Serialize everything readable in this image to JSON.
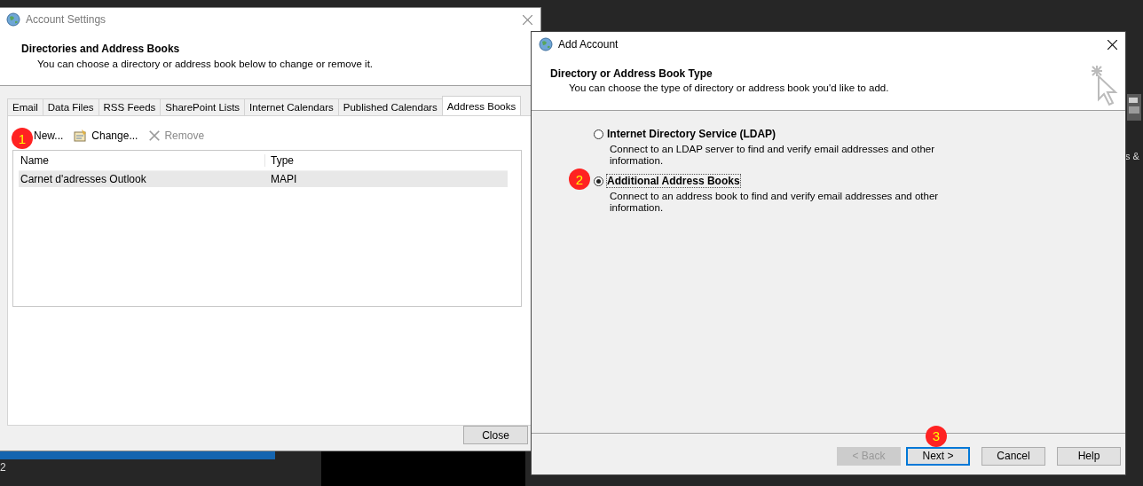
{
  "background": {
    "texts": [
      {
        "text": "2",
        "selected": false
      }
    ],
    "side_text": "s &"
  },
  "account_settings": {
    "title": "Account Settings",
    "header_title": "Directories and Address Books",
    "header_subtitle": "You can choose a directory or address book below to change or remove it.",
    "tabs": [
      {
        "label": "Email",
        "selected": false
      },
      {
        "label": "Data Files",
        "selected": false
      },
      {
        "label": "RSS Feeds",
        "selected": false
      },
      {
        "label": "SharePoint Lists",
        "selected": false
      },
      {
        "label": "Internet Calendars",
        "selected": false
      },
      {
        "label": "Published Calendars",
        "selected": false
      },
      {
        "label": "Address Books",
        "selected": true
      }
    ],
    "toolbar": [
      {
        "kind": "new",
        "label": "New...",
        "disabled": false,
        "badge": "1"
      },
      {
        "kind": "change",
        "label": "Change...",
        "disabled": false
      },
      {
        "kind": "remove",
        "label": "Remove",
        "disabled": true
      }
    ],
    "table": {
      "columns": [
        "Name",
        "Type"
      ],
      "rows": [
        {
          "name": "Carnet d'adresses Outlook",
          "type": "MAPI",
          "selected": true
        }
      ]
    },
    "close_button": "Close"
  },
  "add_account": {
    "title": "Add Account",
    "header_title": "Directory or Address Book Type",
    "header_subtitle": "You can choose the type of directory or address book you'd like to add.",
    "options": [
      {
        "label": "Internet Directory Service (LDAP)",
        "description": "Connect to an LDAP server to find and verify email addresses and other information.",
        "selected": false
      },
      {
        "label": "Additional Address Books",
        "description": "Connect to an address book to find and verify email addresses and other information.",
        "selected": true,
        "badge": "2"
      }
    ],
    "buttons": [
      {
        "label": "< Back",
        "disabled": true,
        "focused": false
      },
      {
        "label": "Next >",
        "disabled": false,
        "focused": true,
        "badge": "3"
      },
      {
        "label": "Cancel",
        "disabled": false,
        "focused": false
      },
      {
        "label": "Help",
        "disabled": false,
        "focused": false
      }
    ]
  }
}
